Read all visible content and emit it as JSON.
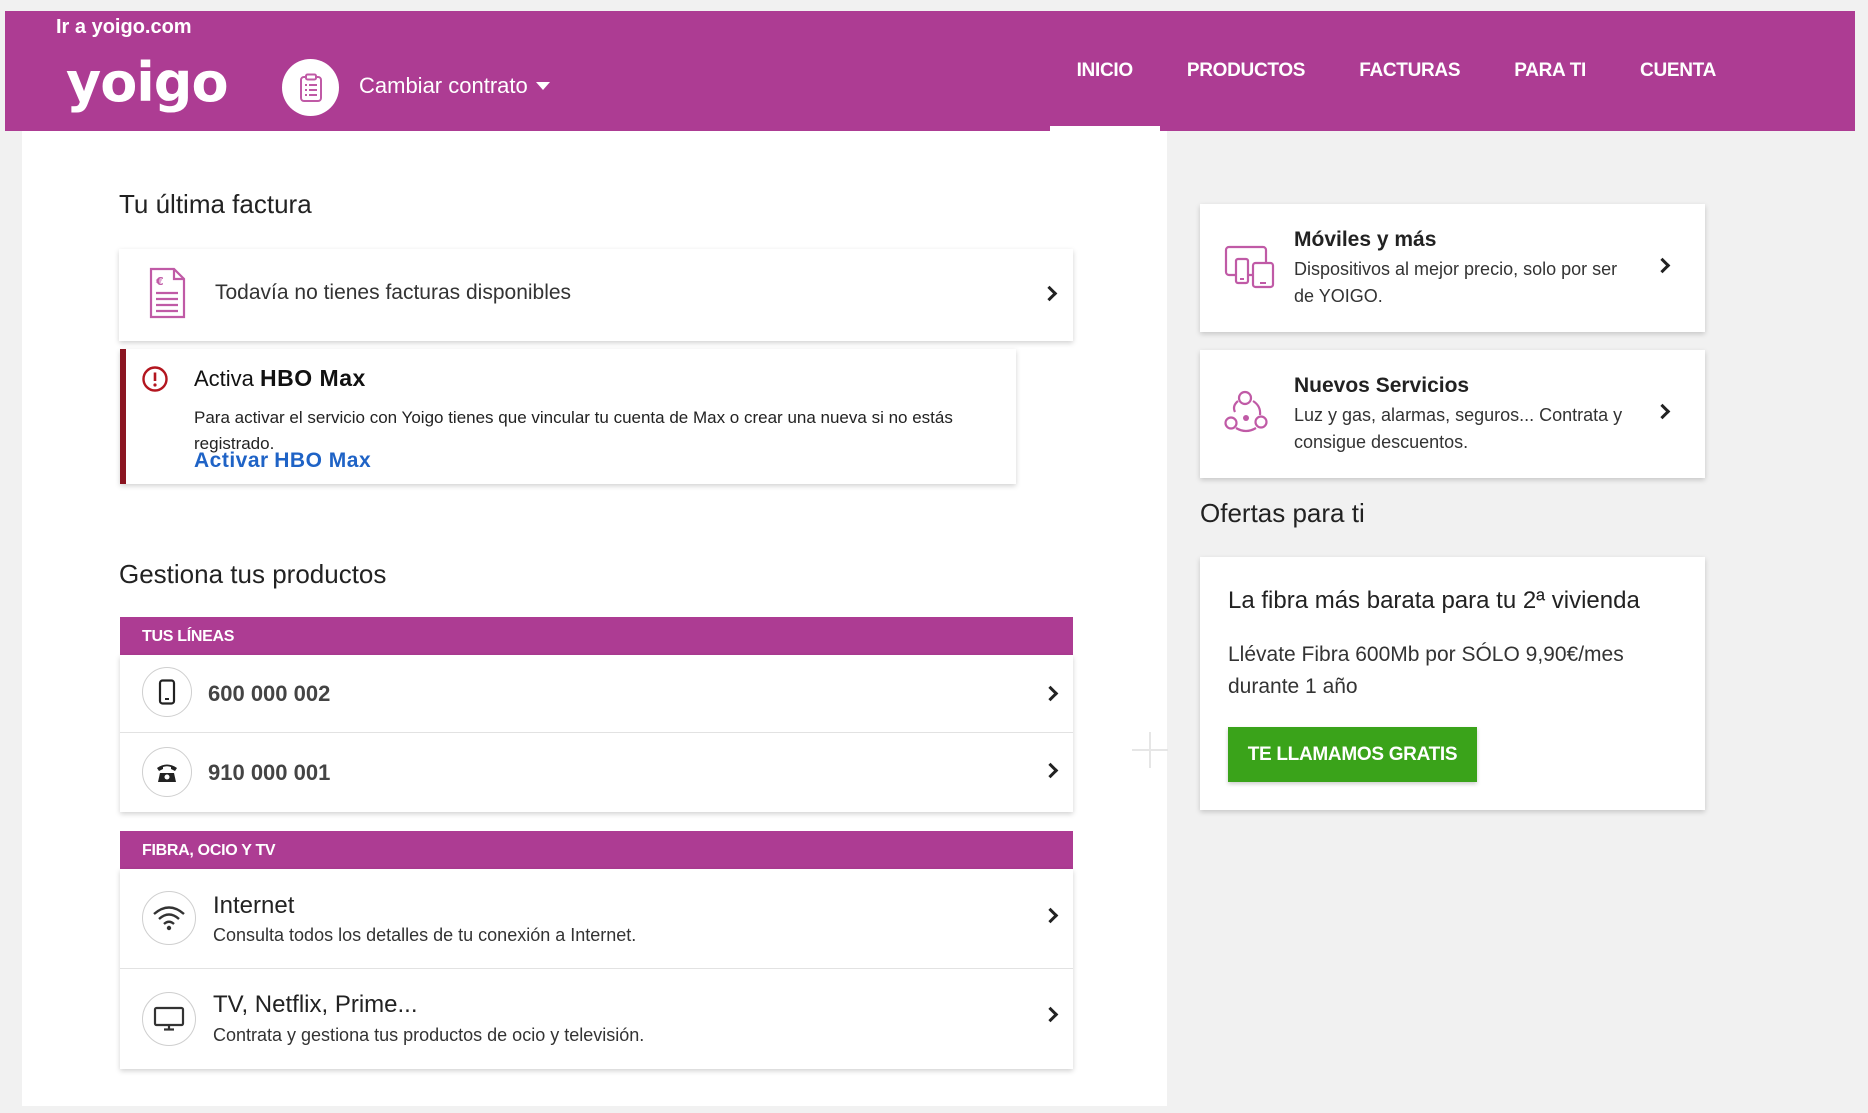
{
  "header": {
    "goto_link": "Ir a yoigo.com",
    "logo": "yoigo",
    "contract_label": "Cambiar contrato",
    "nav": [
      {
        "label": "INICIO",
        "active": true
      },
      {
        "label": "PRODUCTOS",
        "active": false
      },
      {
        "label": "FACTURAS",
        "active": false
      },
      {
        "label": "PARA TI",
        "active": false
      },
      {
        "label": "CUENTA",
        "active": false
      }
    ]
  },
  "invoice": {
    "section_title": "Tu última factura",
    "message": "Todavía no tienes facturas disponibles"
  },
  "hbo": {
    "title_prefix": "Activa",
    "title_brand": "HBO Max",
    "description": "Para activar el servicio con Yoigo tienes que vincular tu cuenta de Max o crear una nueva si no estás registrado.",
    "link_prefix": "Activar",
    "link_brand": "HBO Max"
  },
  "products": {
    "section_title": "Gestiona tus productos",
    "lines_header": "TUS LÍNEAS",
    "lines": [
      {
        "number": "600 000 002",
        "icon": "mobile-phone-icon"
      },
      {
        "number": "910 000 001",
        "icon": "landline-phone-icon"
      }
    ],
    "fibra_header": "FIBRA, OCIO Y TV",
    "fibra_items": [
      {
        "title": "Internet",
        "subtitle": "Consulta todos los detalles de tu conexión a Internet.",
        "icon": "wifi-icon"
      },
      {
        "title": "TV, Netflix, Prime...",
        "subtitle": "Contrata y gestiona tus productos de ocio y televisión.",
        "icon": "tv-icon"
      }
    ]
  },
  "side": {
    "moviles": {
      "title": "Móviles y más",
      "description": "Dispositivos al mejor precio, solo por ser de YOIGO."
    },
    "servicios": {
      "title": "Nuevos Servicios",
      "description": "Luz y gas, alarmas, seguros... Contrata y consigue descuentos."
    }
  },
  "offers": {
    "section_title": "Ofertas para ti",
    "title": "La fibra más barata para tu 2ª vivienda",
    "description": "Llévate Fibra 600Mb por SÓLO 9,90€/mes durante 1 año",
    "button": "TE LLAMAMOS GRATIS"
  },
  "colors": {
    "brand": "#ad3c93",
    "alert": "#8b1521",
    "link": "#1f63c6",
    "cta": "#3aa31a"
  }
}
